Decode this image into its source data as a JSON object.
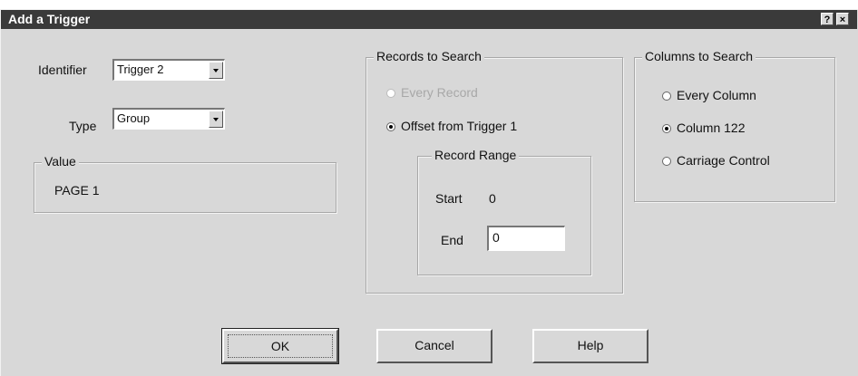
{
  "window": {
    "title": "Add a Trigger",
    "help_glyph": "?",
    "close_glyph": "×"
  },
  "identifier": {
    "label": "Identifier",
    "value": "Trigger 2"
  },
  "type": {
    "label": "Type",
    "value": "Group"
  },
  "value_group": {
    "title": "Value",
    "content": "PAGE 1"
  },
  "records_to_search": {
    "title": "Records to Search",
    "options": [
      {
        "label": "Every Record",
        "selected": false,
        "enabled": false
      },
      {
        "label": "Offset from Trigger 1",
        "selected": true,
        "enabled": true
      }
    ],
    "record_range": {
      "title": "Record Range",
      "start_label": "Start",
      "start_value": "0",
      "end_label": "End",
      "end_value": "0"
    }
  },
  "columns_to_search": {
    "title": "Columns to Search",
    "options": [
      {
        "label": "Every Column",
        "selected": false
      },
      {
        "label": "Column 122",
        "selected": true
      },
      {
        "label": "Carriage Control",
        "selected": false
      }
    ]
  },
  "buttons": {
    "ok": "OK",
    "cancel": "Cancel",
    "help": "Help"
  }
}
